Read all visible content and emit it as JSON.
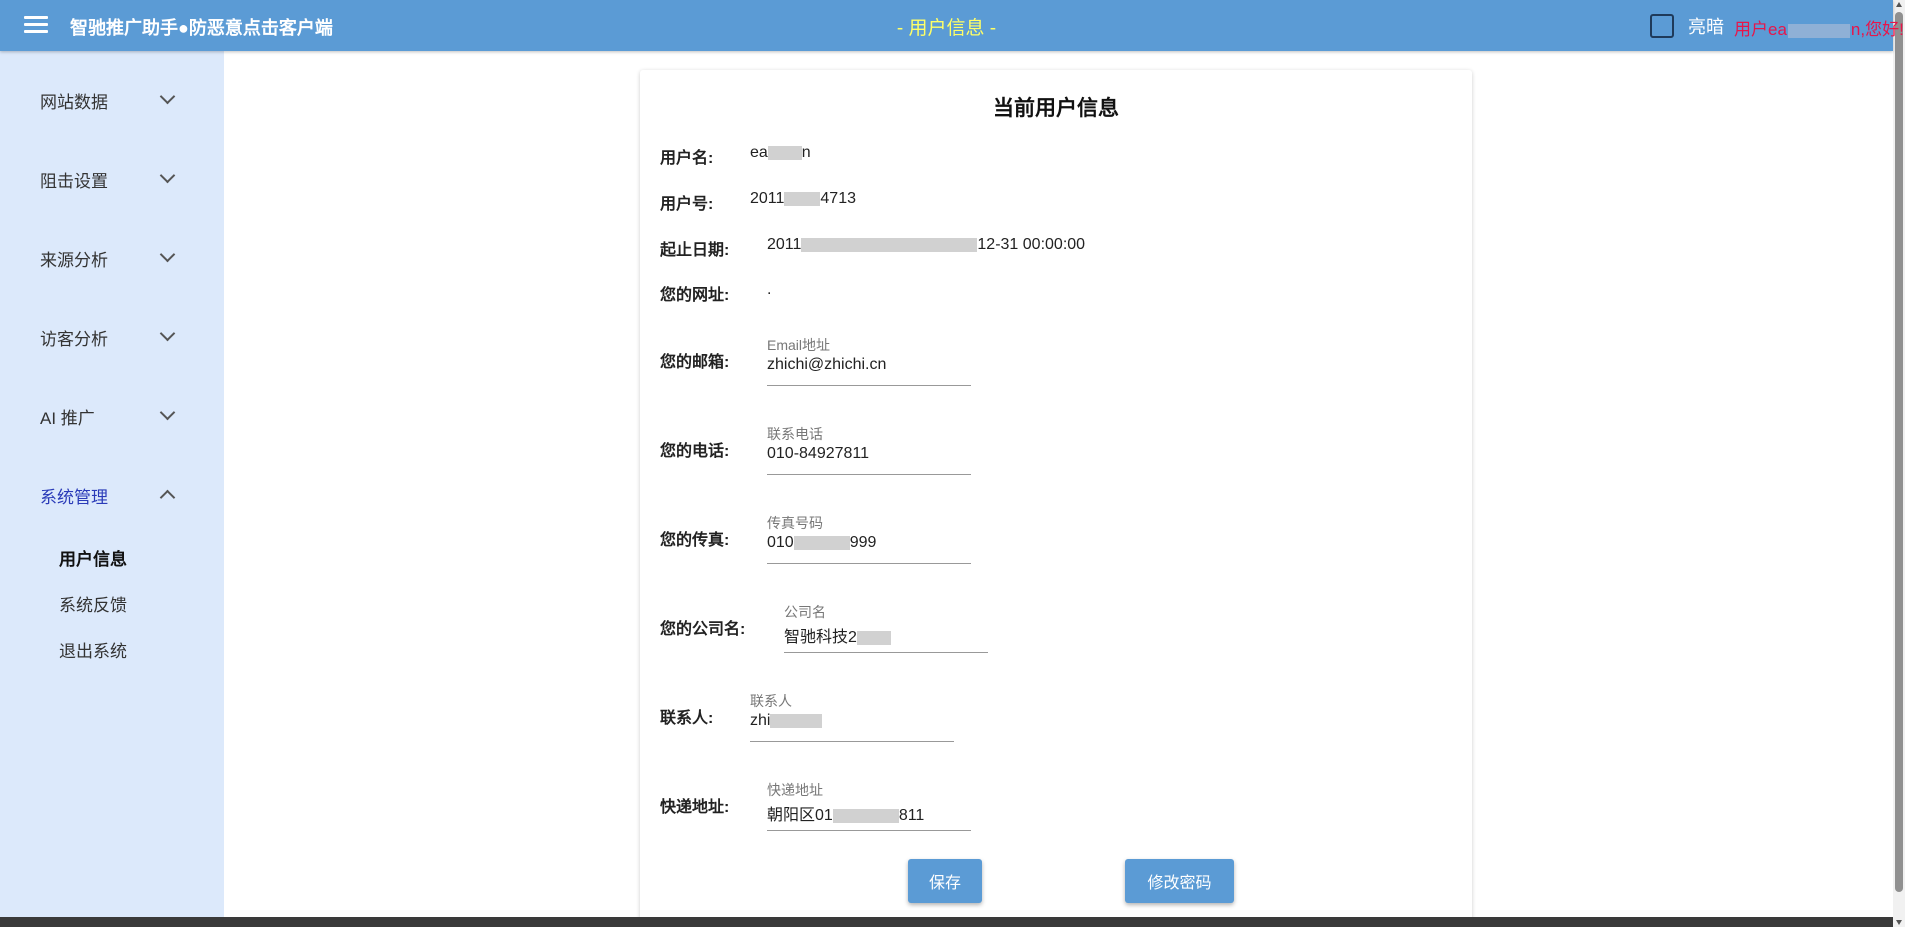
{
  "app": {
    "title": "智驰推广助手●防恶意点击客户端",
    "page_heading": "- 用户信息 -",
    "theme_label": "亮暗",
    "greeting_prefix": "用户ea",
    "greeting_suffix": "n,您好!"
  },
  "sidebar": {
    "groups": [
      {
        "label": "网站数据",
        "expanded": false
      },
      {
        "label": "阻击设置",
        "expanded": false
      },
      {
        "label": "来源分析",
        "expanded": false
      },
      {
        "label": "访客分析",
        "expanded": false
      },
      {
        "label": "AI 推广",
        "expanded": false
      },
      {
        "label": "系统管理",
        "expanded": true
      }
    ],
    "sub_items": [
      {
        "label": "用户信息",
        "active": true
      },
      {
        "label": "系统反馈",
        "active": false
      },
      {
        "label": "退出系统",
        "active": false
      }
    ]
  },
  "card": {
    "title": "当前用户信息",
    "username": {
      "label": "用户名:",
      "value_prefix": "ea",
      "value_suffix": "n"
    },
    "user_id": {
      "label": "用户号:",
      "value_prefix": "2011",
      "value_suffix": "4713"
    },
    "date_range": {
      "label": "起止日期:",
      "value_prefix": "2011",
      "value_suffix": "12-31 00:00:00"
    },
    "website": {
      "label": "您的网址:",
      "value": "."
    },
    "email": {
      "label": "您的邮箱:",
      "field_label": "Email地址",
      "value": "zhichi@zhichi.cn"
    },
    "phone": {
      "label": "您的电话:",
      "field_label": "联系电话",
      "value": "010-84927811"
    },
    "fax": {
      "label": "您的传真:",
      "field_label": "传真号码",
      "value_prefix": "010",
      "value_suffix": "999"
    },
    "company": {
      "label": "您的公司名:",
      "field_label": "公司名",
      "value_prefix": "智驰科技2",
      "value_suffix": ""
    },
    "contact": {
      "label": "联系人:",
      "field_label": "联系人",
      "value_prefix": "zhi",
      "value_suffix": ""
    },
    "address": {
      "label": "快递地址:",
      "field_label": "快递地址",
      "value_prefix": "朝阳区01",
      "value_suffix": "811"
    },
    "buttons": {
      "save": "保存",
      "change_password": "修改密码"
    }
  },
  "colors": {
    "appbar": "#5b9bd5",
    "heading": "#ffff66",
    "greeting": "#e8154a",
    "sidebar": "#dce9fb",
    "active_nav": "#2a3bb8",
    "button": "#5b9bd5"
  },
  "icons": [
    "menu-icon",
    "chevron-down-icon",
    "chevron-up-icon",
    "checkbox-icon"
  ]
}
